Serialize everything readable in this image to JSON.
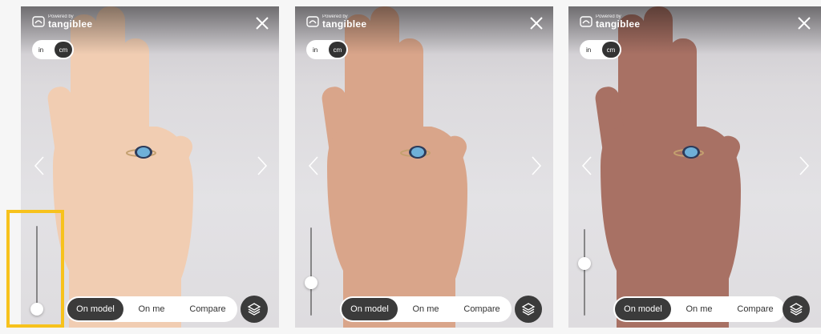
{
  "brand": {
    "powered_by": "Powered by",
    "name": "tangiblee"
  },
  "units": {
    "inch": "in",
    "cm": "cm",
    "selected": "cm"
  },
  "modes": {
    "on_model": "On model",
    "on_me": "On me",
    "compare": "Compare",
    "selected": "On model"
  },
  "icons": [
    "tangiblee-logo-icon",
    "close-icon",
    "chevron-left-icon",
    "chevron-right-icon",
    "layers-icon"
  ],
  "panels": [
    {
      "skin_tone_level": 0.0,
      "skin_color": "#f1cdb2"
    },
    {
      "skin_tone_level": 0.35,
      "skin_color": "#d9a58a"
    },
    {
      "skin_tone_level": 0.62,
      "skin_color": "#a87164"
    }
  ],
  "colors": {
    "highlight": "#f7c21c",
    "active_pill": "#3b3b3b",
    "ring_stone": "#6fb0d8"
  }
}
